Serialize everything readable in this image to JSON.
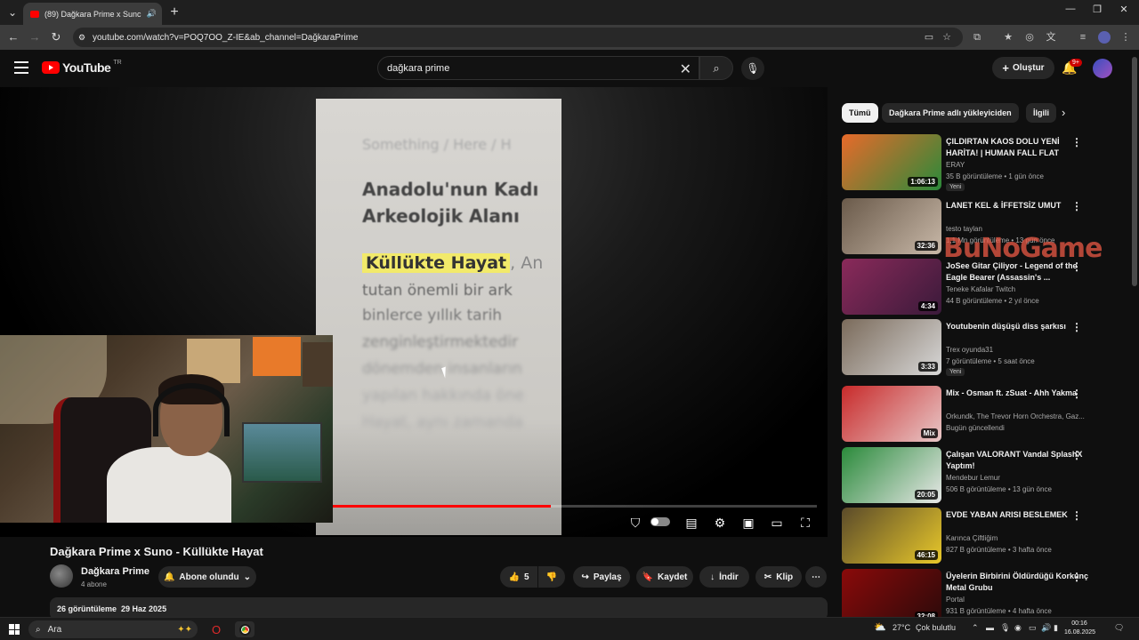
{
  "browser": {
    "tab_title": "(89) Dağkara Prime x Sunc",
    "url": "youtube.com/watch?v=POQ7OO_Z-IE&ab_channel=DağkaraPrime",
    "colors": {
      "tabbar": "#1f1f1f",
      "accent": "#ff0000"
    }
  },
  "header": {
    "logo_text": "YouTube",
    "region": "TR",
    "search_value": "dağkara prime",
    "create_label": "Oluştur",
    "notification_badge": "9+"
  },
  "video": {
    "frame_text": {
      "line1": "Something / Here / H",
      "line2": "Anadolu'nun Kadı",
      "line3": "Arkeolojik Alanı",
      "highlight": "Küllükte Hayat",
      "highlight_rest": ", An",
      "line5": "tutan önemli bir ark",
      "line6": "binlerce yıllık tarih",
      "line7": "zenginleştirmektedir",
      "line8": "dönemden insanların",
      "line9": "yapılan hakkında öne",
      "line10": "Hayat, aynı zamanda"
    },
    "progress": 0.67,
    "title": "Dağkara Prime x Suno - Küllükte Hayat",
    "channel_name": "Dağkara Prime",
    "subscribers": "4 abone",
    "subscribed_label": "Abone olundu",
    "likes": "5",
    "share_label": "Paylaş",
    "save_label": "Kaydet",
    "download_label": "İndir",
    "clip_label": "Klip",
    "views": "26 görüntüleme",
    "date": "29 Haz 2025"
  },
  "chips": [
    "Tümü",
    "Dağkara Prime adlı yükleyiciden",
    "İlgili"
  ],
  "watermark": "BuNoGame",
  "recommendations": [
    {
      "title": "ÇILDIRTAN KAOS DOLU YENİ HARİTA! | HUMAN FALL FLAT",
      "channel": "ERAY",
      "meta": "35 B görüntüleme • 1 gün önce",
      "duration": "1:06:13",
      "badge": "Yeni",
      "thumb_colors": [
        "#e86a2a",
        "#2a8a3a"
      ]
    },
    {
      "title": "LANET KEL & İFFETSİZ UMUT",
      "channel": "testo taylan",
      "meta": "1,1 Mn görüntüleme • 13 gün önce",
      "duration": "32:36",
      "badge": "",
      "thumb_colors": [
        "#6a5a4a",
        "#c8b8a8"
      ]
    },
    {
      "title": "JoSee Gitar Çiliyor - Legend of the Eagle Bearer (Assassin's ...",
      "channel": "Teneke Kafalar Twitch",
      "meta": "44 B görüntüleme • 2 yıl önce",
      "duration": "4:34",
      "badge": "",
      "thumb_colors": [
        "#8a2a5a",
        "#3a1a3a"
      ]
    },
    {
      "title": "Youtubenin düşüşü diss şarkısı",
      "channel": "Trex oyunda31",
      "meta": "7 görüntüleme • 5 saat önce",
      "duration": "3:33",
      "badge": "Yeni",
      "thumb_colors": [
        "#7a6a5a",
        "#d8d8d8"
      ]
    },
    {
      "title": "Mix - Osman ft. zSuat - Ahh Yakma",
      "channel": "Orkundk, The Trevor Horn Orchestra, Gaz...",
      "meta": "Bugün güncellendi",
      "duration": "Mix",
      "badge": "",
      "thumb_colors": [
        "#c82a2a",
        "#e8c8c8"
      ]
    },
    {
      "title": "Çalışan VALORANT Vandal SplashX Yaptım!",
      "channel": "Mendebur Lemur",
      "meta": "506 B görüntüleme • 13 gün önce",
      "duration": "20:05",
      "badge": "",
      "thumb_colors": [
        "#2a8a3a",
        "#e8e8e8"
      ]
    },
    {
      "title": "EVDE YABAN ARISI BESLEMEK",
      "channel": "Karınca Çiftliğim",
      "meta": "827 B görüntüleme • 3 hafta önce",
      "duration": "46:15",
      "badge": "",
      "thumb_colors": [
        "#5a4a2a",
        "#e8c82a"
      ]
    },
    {
      "title": "Üyelerin Birbirini Öldürdüğü Korkunç Metal Grubu",
      "channel": "Portal",
      "meta": "931 B görüntüleme • 4 hafta önce",
      "duration": "32:08",
      "badge": "",
      "thumb_colors": [
        "#8a0a0a",
        "#2a0a0a"
      ]
    }
  ],
  "taskbar": {
    "search_placeholder": "Ara",
    "weather": "27°C",
    "weather_desc": "Çok bulutlu",
    "time": "00:16",
    "date": "16.08.2025"
  }
}
